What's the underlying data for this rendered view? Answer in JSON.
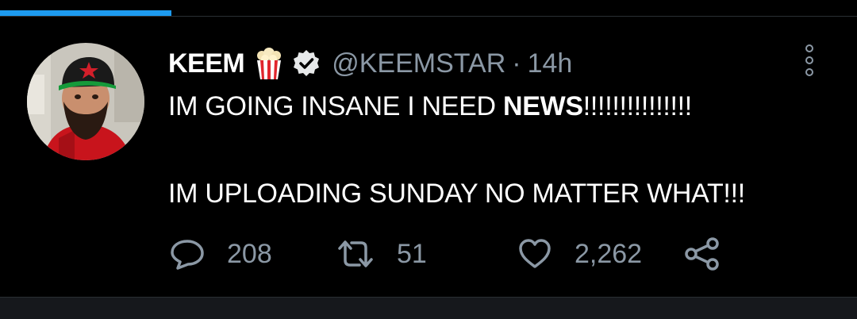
{
  "progress": {
    "fraction": 0.2
  },
  "tweet": {
    "author": {
      "name": "KEEM",
      "name_emoji": "popcorn-icon",
      "verified": true,
      "handle": "@KEEMSTAR",
      "separator": "·",
      "time": "14h"
    },
    "lines": [
      {
        "prefix": "IM GOING INSANE I NEED ",
        "bold": "NEWS",
        "suffix": "!!!!!!!!!!!!!!!"
      },
      {
        "prefix": "IM UPLOADING SUNDAY NO MATTER WHAT!!!"
      }
    ],
    "actions": {
      "replies": "208",
      "retweets": "51",
      "likes": "2,262"
    }
  },
  "icons": {
    "reply": "speech-bubble-icon",
    "retweet": "retweet-icon",
    "like": "heart-icon",
    "share": "share-icon",
    "more": "more-vertical-icon"
  },
  "colors": {
    "background": "#000000",
    "text": "#ffffff",
    "muted": "#8b98a5",
    "accent": "#1d9bf0"
  }
}
